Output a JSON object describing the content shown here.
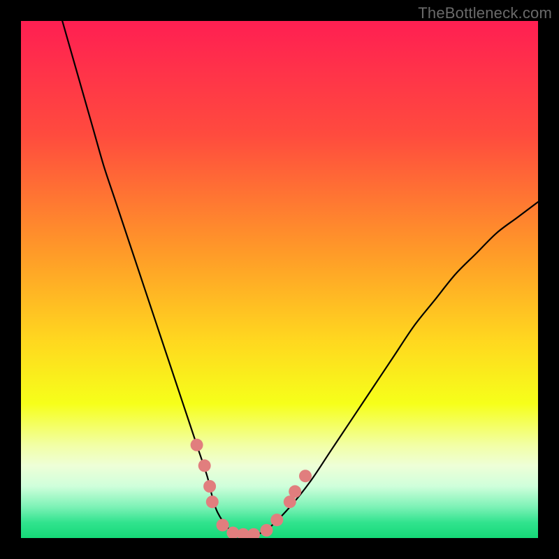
{
  "watermark": "TheBottleneck.com",
  "chart_data": {
    "type": "line",
    "title": "",
    "xlabel": "",
    "ylabel": "",
    "xlim": [
      0,
      100
    ],
    "ylim": [
      0,
      100
    ],
    "gradient_stops": [
      {
        "offset": 0.0,
        "color": "#ff1f52"
      },
      {
        "offset": 0.22,
        "color": "#ff4b3e"
      },
      {
        "offset": 0.45,
        "color": "#ff9b28"
      },
      {
        "offset": 0.62,
        "color": "#ffd81f"
      },
      {
        "offset": 0.74,
        "color": "#f6ff1a"
      },
      {
        "offset": 0.82,
        "color": "#f2ffa5"
      },
      {
        "offset": 0.86,
        "color": "#eeffd7"
      },
      {
        "offset": 0.9,
        "color": "#cfffdb"
      },
      {
        "offset": 0.94,
        "color": "#7cf2b6"
      },
      {
        "offset": 0.97,
        "color": "#31e38e"
      },
      {
        "offset": 1.0,
        "color": "#15d977"
      }
    ],
    "series": [
      {
        "name": "bottleneck-curve",
        "x": [
          8,
          10,
          12,
          14,
          16,
          18,
          20,
          22,
          24,
          26,
          28,
          30,
          32,
          34,
          36,
          37,
          38,
          40,
          42,
          45,
          48,
          52,
          56,
          60,
          64,
          68,
          72,
          76,
          80,
          84,
          88,
          92,
          96,
          100
        ],
        "y": [
          100,
          93,
          86,
          79,
          72,
          66,
          60,
          54,
          48,
          42,
          36,
          30,
          24,
          18,
          12,
          8,
          5,
          2,
          0.5,
          0.5,
          2,
          6,
          11,
          17,
          23,
          29,
          35,
          41,
          46,
          51,
          55,
          59,
          62,
          65
        ]
      }
    ],
    "markers": {
      "name": "highlight-dots",
      "color": "#e17e7e",
      "radius_px": 9,
      "points": [
        {
          "x": 34.0,
          "y": 18
        },
        {
          "x": 35.5,
          "y": 14
        },
        {
          "x": 36.5,
          "y": 10
        },
        {
          "x": 37.0,
          "y": 7
        },
        {
          "x": 39.0,
          "y": 2.5
        },
        {
          "x": 41.0,
          "y": 1.0
        },
        {
          "x": 43.0,
          "y": 0.7
        },
        {
          "x": 45.0,
          "y": 0.7
        },
        {
          "x": 47.5,
          "y": 1.5
        },
        {
          "x": 49.5,
          "y": 3.5
        },
        {
          "x": 52.0,
          "y": 7.0
        },
        {
          "x": 53.0,
          "y": 9.0
        },
        {
          "x": 55.0,
          "y": 12.0
        }
      ]
    }
  }
}
